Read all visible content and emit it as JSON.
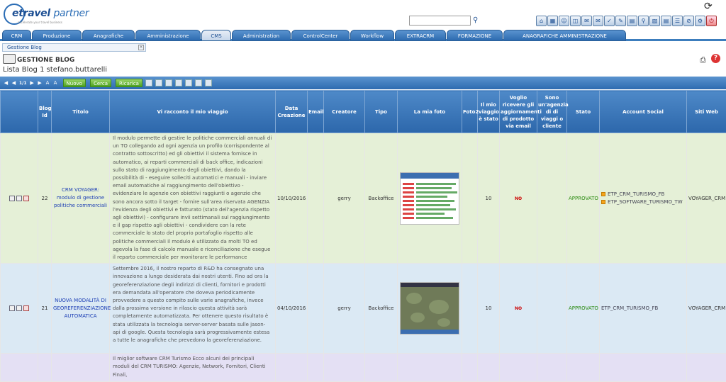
{
  "app": {
    "logo_text_a": "etravel",
    "logo_text_b": "partner",
    "logo_tagline": "accelerate your travel business"
  },
  "search": {
    "placeholder": "",
    "value": ""
  },
  "top_tabs": [
    {
      "label": "CRM"
    },
    {
      "label": "Produzione"
    },
    {
      "label": "Anagrafiche"
    },
    {
      "label": "Amministrazione"
    },
    {
      "label": "CMS",
      "active": true
    },
    {
      "label": "Administration"
    },
    {
      "label": "ControlCenter"
    },
    {
      "label": "Workflow"
    },
    {
      "label": "EXTRACRM"
    },
    {
      "label": "FORMAZIONE"
    },
    {
      "label": "ANAGRAFICHE AMMINISTRAZIONE"
    }
  ],
  "subtab": {
    "label": "Gestione Blog"
  },
  "header": {
    "title": "GESTIONE BLOG",
    "list_label": "Lista Blog",
    "list_count": "1",
    "user": "stefano.buttarelli"
  },
  "gridbar": {
    "pager": "1/1",
    "btn_new": "Nuovo",
    "btn_search": "Cerca",
    "btn_reload": "Ricarica"
  },
  "columns": [
    "",
    "Blog Id",
    "Titolo",
    "Vi racconto il mio viaggio",
    "Data Creazione",
    "Email",
    "Creatore",
    "Tipo",
    "La mia foto",
    "Foto2",
    "Il mio viaggio è stato",
    "Voglio ricevere gli aggiornamenti di prodotto via email",
    "Sono un'agenzia di di viaggi o cliente",
    "Stato",
    "Account Social",
    "Siti Web"
  ],
  "rows": [
    {
      "id": "22",
      "title": "CRM VOYAGER: modulo di gestione politiche commerciali",
      "description": "Il modulo permette di gestire le politiche commerciali annuali di un TO collegando ad ogni agenzia un profilo (corrispondente al contratto sottoscritto) ed gli obiettivi il sistema fornisce in automatico, ai reparti commerciali di back office, indicazioni sullo stato di raggiungimento degli obiettivi, dando la possibilità di - eseguire solleciti automatici e manuali - inviare email automatiche al raggiungimento dell'obiettivo - evidenziare le agenzie con obiettivi raggiunti o agenzie che sono ancora sotto il target - fornire sull'area riservata AGENZIA l'evidenza degli obiettivi e fatturato (stato dell'agenzia rispetto agli obiettivi) - configurare invii settimanali sul raggiungimento e il gap rispetto agli obiettivi - condividere con la rete commerciale lo stato del proprio portafoglio rispetto alle politiche commerciali il modulo è utilizzato da molti TO ed agevola la fase di calcolo manuale e riconciliazione che esegue il reparto commerciale per monitorare le performance",
      "date": "10/10/2016",
      "email": "",
      "creator": "gerry",
      "type": "Backoffice",
      "foto2": "",
      "rating": "10",
      "updates": "NO",
      "agency": "",
      "status": "APPROVATO",
      "social": [
        "ETP_CRM_TURISMO_FB",
        "ETP_SOFTWARE_TURISMO_TW"
      ],
      "site": "VOYAGER_CRM"
    },
    {
      "id": "21",
      "title": "NUOVA MODALITÀ DI GEOREFERENZIAZIONE AUTOMATICA",
      "description": "Settembre 2016, il nostro reparto di R&D ha consegnato una innovazione a lungo desiderata dai nostri utenti. Fino ad ora la georeferenziazione degli indirizzi di clienti, fornitori e prodotti era demandata all'operatore che doveva periodicamente provvedere a questo compito sulle varie anagrafiche, invece dalla prossima versione in rilascio questa attività sarà completamente automatizzata. Per ottenere questo risultato è stata utilizzata la tecnologia server-server basata sulle jason-api di google. Questa tecnologia sarà progressivamente estesa a tutte le anagrafiche che prevedono la georeferenziazione.",
      "date": "04/10/2016",
      "email": "",
      "creator": "gerry",
      "type": "Backoffice",
      "foto2": "",
      "rating": "10",
      "updates": "NO",
      "agency": "",
      "status": "APPROVATO",
      "social": [
        "ETP_CRM_TURISMO_FB"
      ],
      "site": "VOYAGER_CRM"
    },
    {
      "id": "",
      "title": "",
      "description": "Il miglior software CRM Turismo Ecco alcuni dei principali moduli del CRM TURISMO: Agenzie, Network, Fornitori, Clienti Finali,",
      "date": "",
      "email": "",
      "creator": "",
      "type": "",
      "foto2": "",
      "rating": "",
      "updates": "",
      "agency": "",
      "status": "",
      "social": [],
      "site": ""
    }
  ],
  "colors": {
    "tab_blue": "#2d6bb0",
    "row_green": "#e5f0d7",
    "row_blue": "#dbe9f4",
    "row_lilac": "#e4e0f4",
    "status_green": "#2b8a12",
    "no_red": "#c00000"
  }
}
